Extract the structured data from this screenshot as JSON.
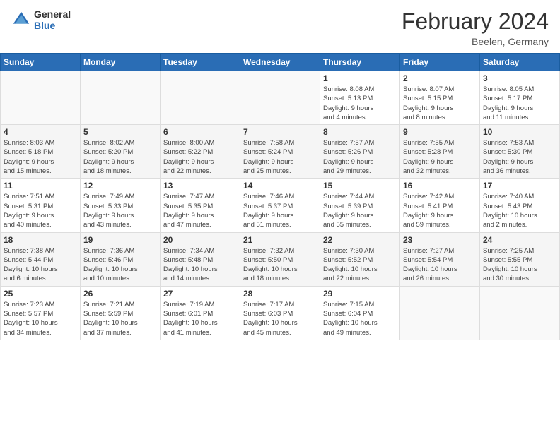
{
  "header": {
    "logo_general": "General",
    "logo_blue": "Blue",
    "main_title": "February 2024",
    "subtitle": "Beelen, Germany"
  },
  "calendar": {
    "days_of_week": [
      "Sunday",
      "Monday",
      "Tuesday",
      "Wednesday",
      "Thursday",
      "Friday",
      "Saturday"
    ],
    "weeks": [
      [
        {
          "day": "",
          "info": ""
        },
        {
          "day": "",
          "info": ""
        },
        {
          "day": "",
          "info": ""
        },
        {
          "day": "",
          "info": ""
        },
        {
          "day": "1",
          "info": "Sunrise: 8:08 AM\nSunset: 5:13 PM\nDaylight: 9 hours\nand 4 minutes."
        },
        {
          "day": "2",
          "info": "Sunrise: 8:07 AM\nSunset: 5:15 PM\nDaylight: 9 hours\nand 8 minutes."
        },
        {
          "day": "3",
          "info": "Sunrise: 8:05 AM\nSunset: 5:17 PM\nDaylight: 9 hours\nand 11 minutes."
        }
      ],
      [
        {
          "day": "4",
          "info": "Sunrise: 8:03 AM\nSunset: 5:18 PM\nDaylight: 9 hours\nand 15 minutes."
        },
        {
          "day": "5",
          "info": "Sunrise: 8:02 AM\nSunset: 5:20 PM\nDaylight: 9 hours\nand 18 minutes."
        },
        {
          "day": "6",
          "info": "Sunrise: 8:00 AM\nSunset: 5:22 PM\nDaylight: 9 hours\nand 22 minutes."
        },
        {
          "day": "7",
          "info": "Sunrise: 7:58 AM\nSunset: 5:24 PM\nDaylight: 9 hours\nand 25 minutes."
        },
        {
          "day": "8",
          "info": "Sunrise: 7:57 AM\nSunset: 5:26 PM\nDaylight: 9 hours\nand 29 minutes."
        },
        {
          "day": "9",
          "info": "Sunrise: 7:55 AM\nSunset: 5:28 PM\nDaylight: 9 hours\nand 32 minutes."
        },
        {
          "day": "10",
          "info": "Sunrise: 7:53 AM\nSunset: 5:30 PM\nDaylight: 9 hours\nand 36 minutes."
        }
      ],
      [
        {
          "day": "11",
          "info": "Sunrise: 7:51 AM\nSunset: 5:31 PM\nDaylight: 9 hours\nand 40 minutes."
        },
        {
          "day": "12",
          "info": "Sunrise: 7:49 AM\nSunset: 5:33 PM\nDaylight: 9 hours\nand 43 minutes."
        },
        {
          "day": "13",
          "info": "Sunrise: 7:47 AM\nSunset: 5:35 PM\nDaylight: 9 hours\nand 47 minutes."
        },
        {
          "day": "14",
          "info": "Sunrise: 7:46 AM\nSunset: 5:37 PM\nDaylight: 9 hours\nand 51 minutes."
        },
        {
          "day": "15",
          "info": "Sunrise: 7:44 AM\nSunset: 5:39 PM\nDaylight: 9 hours\nand 55 minutes."
        },
        {
          "day": "16",
          "info": "Sunrise: 7:42 AM\nSunset: 5:41 PM\nDaylight: 9 hours\nand 59 minutes."
        },
        {
          "day": "17",
          "info": "Sunrise: 7:40 AM\nSunset: 5:43 PM\nDaylight: 10 hours\nand 2 minutes."
        }
      ],
      [
        {
          "day": "18",
          "info": "Sunrise: 7:38 AM\nSunset: 5:44 PM\nDaylight: 10 hours\nand 6 minutes."
        },
        {
          "day": "19",
          "info": "Sunrise: 7:36 AM\nSunset: 5:46 PM\nDaylight: 10 hours\nand 10 minutes."
        },
        {
          "day": "20",
          "info": "Sunrise: 7:34 AM\nSunset: 5:48 PM\nDaylight: 10 hours\nand 14 minutes."
        },
        {
          "day": "21",
          "info": "Sunrise: 7:32 AM\nSunset: 5:50 PM\nDaylight: 10 hours\nand 18 minutes."
        },
        {
          "day": "22",
          "info": "Sunrise: 7:30 AM\nSunset: 5:52 PM\nDaylight: 10 hours\nand 22 minutes."
        },
        {
          "day": "23",
          "info": "Sunrise: 7:27 AM\nSunset: 5:54 PM\nDaylight: 10 hours\nand 26 minutes."
        },
        {
          "day": "24",
          "info": "Sunrise: 7:25 AM\nSunset: 5:55 PM\nDaylight: 10 hours\nand 30 minutes."
        }
      ],
      [
        {
          "day": "25",
          "info": "Sunrise: 7:23 AM\nSunset: 5:57 PM\nDaylight: 10 hours\nand 34 minutes."
        },
        {
          "day": "26",
          "info": "Sunrise: 7:21 AM\nSunset: 5:59 PM\nDaylight: 10 hours\nand 37 minutes."
        },
        {
          "day": "27",
          "info": "Sunrise: 7:19 AM\nSunset: 6:01 PM\nDaylight: 10 hours\nand 41 minutes."
        },
        {
          "day": "28",
          "info": "Sunrise: 7:17 AM\nSunset: 6:03 PM\nDaylight: 10 hours\nand 45 minutes."
        },
        {
          "day": "29",
          "info": "Sunrise: 7:15 AM\nSunset: 6:04 PM\nDaylight: 10 hours\nand 49 minutes."
        },
        {
          "day": "",
          "info": ""
        },
        {
          "day": "",
          "info": ""
        }
      ]
    ]
  }
}
